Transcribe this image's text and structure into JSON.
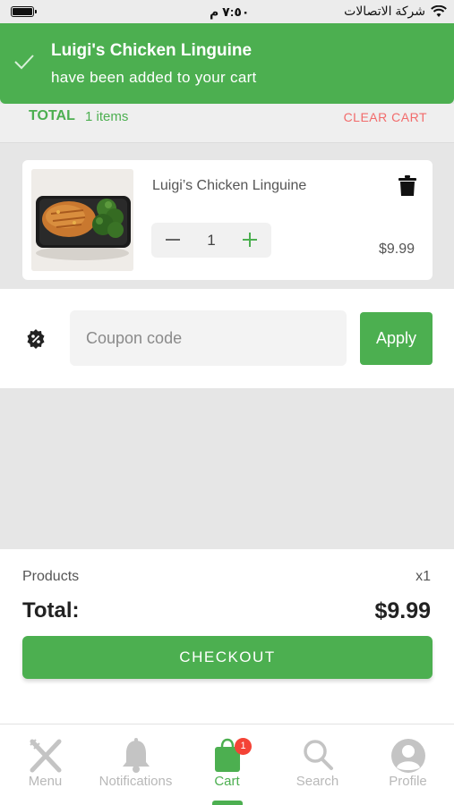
{
  "status_bar": {
    "time": "٧:٥٠ م",
    "carrier": "شركة الاتصالات",
    "icons": [
      "battery-icon",
      "wifi-icon"
    ]
  },
  "toast": {
    "title": "Luigi's Chicken Linguine",
    "message": "have been added to your cart",
    "icon": "check-icon"
  },
  "cart_summary": {
    "total_label": "TOTAL",
    "items_count": "1 items",
    "clear_label": "CLEAR CART"
  },
  "cart_items": [
    {
      "name": "Luigi’s Chicken Linguine",
      "quantity": "1",
      "price": "$9.99",
      "icons": [
        "trash-icon",
        "minus-icon",
        "plus-icon"
      ]
    }
  ],
  "coupon": {
    "placeholder": "Coupon code",
    "value": "",
    "apply_label": "Apply",
    "icon": "discount-badge-icon"
  },
  "order_summary": {
    "products_label": "Products",
    "products_count": "x1",
    "total_label": "Total:",
    "total_value": "$9.99",
    "checkout_label": "CHECKOUT"
  },
  "tab_bar": {
    "tabs": [
      {
        "label": "Menu",
        "icon": "fork-knife-icon",
        "active": false
      },
      {
        "label": "Notifications",
        "icon": "bell-icon",
        "active": false
      },
      {
        "label": "Cart",
        "icon": "shopping-bag-icon",
        "active": true,
        "badge": "1"
      },
      {
        "label": "Search",
        "icon": "search-icon",
        "active": false
      },
      {
        "label": "Profile",
        "icon": "profile-icon",
        "active": false
      }
    ]
  },
  "colors": {
    "accent": "#4caf50",
    "danger": "#f26b6b",
    "badge": "#f44336"
  }
}
